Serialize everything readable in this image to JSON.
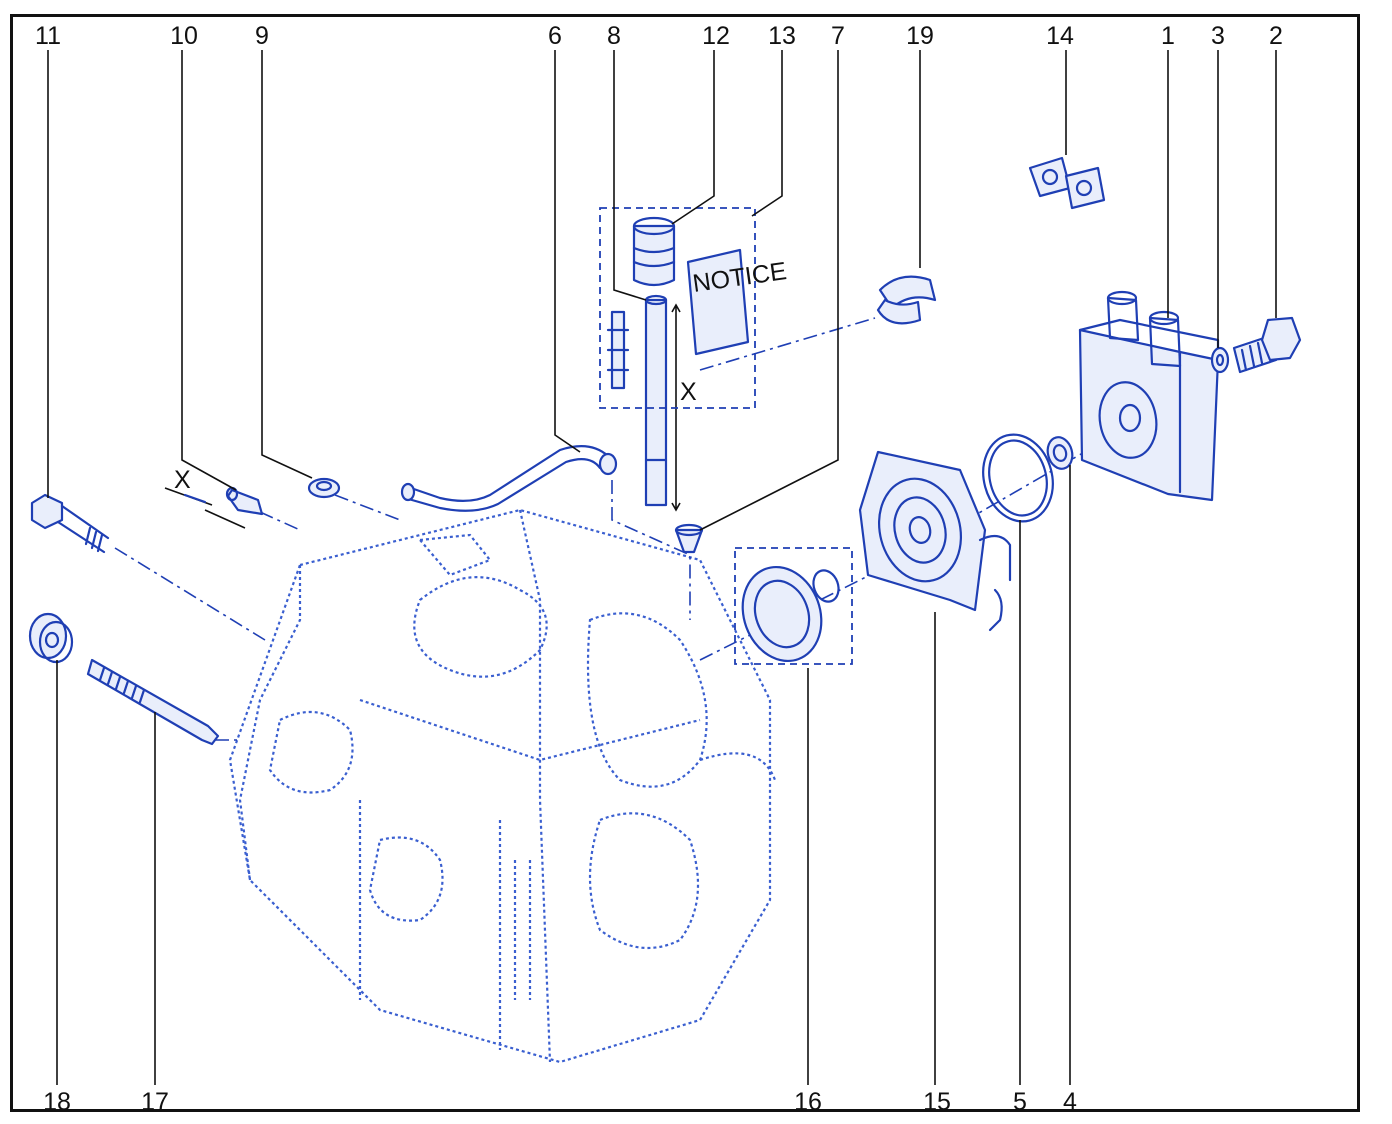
{
  "diagram": {
    "callouts": [
      "1",
      "2",
      "3",
      "4",
      "5",
      "6",
      "7",
      "8",
      "9",
      "10",
      "11",
      "12",
      "13",
      "14",
      "15",
      "16",
      "17",
      "18",
      "19"
    ],
    "notice_label": "NOTICE",
    "dimension_label": "X",
    "colors": {
      "line": "#1f3fb4",
      "callout": "#111111",
      "background": "#ffffff"
    }
  }
}
